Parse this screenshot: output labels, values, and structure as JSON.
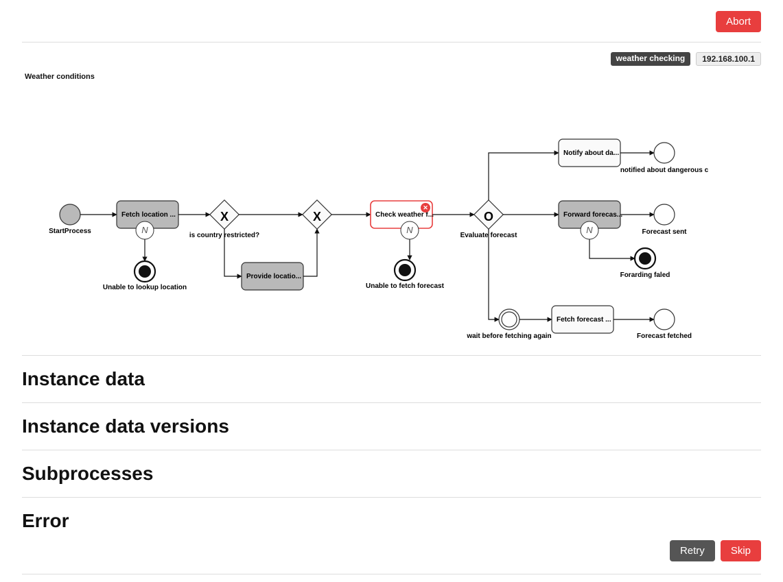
{
  "topbar": {
    "abort": "Abort"
  },
  "meta": {
    "process": "weather checking",
    "node": "192.168.100.1"
  },
  "diagram": {
    "title": "Weather conditions",
    "start": {
      "label": "StartProcess"
    },
    "tasks": {
      "fetchLocation": "Fetch location ...",
      "provideLocation": "Provide locatio...",
      "checkWeather": "Check weather f...",
      "notifyDanger": "Notify about da...",
      "forwardForecast": "Forward forecas...",
      "fetchForecast": "Fetch forecast ..."
    },
    "gateways": {
      "countryRestricted": {
        "marker": "X",
        "label": "is country restricted?"
      },
      "merge": {
        "marker": "X"
      },
      "evaluate": {
        "marker": "O",
        "label": "Evaluate forecast"
      }
    },
    "events": {
      "unableLookup": "Unable to lookup location",
      "unableFetch": "Unable to fetch forecast",
      "waitBefore": "wait before fetching again",
      "notifiedDanger": "notified about dangerous c",
      "forecastSent": "Forecast sent",
      "forwardingFailed": "Forarding faled",
      "forecastFetched": "Forecast fetched"
    }
  },
  "sections": {
    "instanceData": "Instance data",
    "instanceDataVersions": "Instance data versions",
    "subprocesses": "Subprocesses",
    "error": "Error"
  },
  "errorActions": {
    "retry": "Retry",
    "skip": "Skip"
  }
}
